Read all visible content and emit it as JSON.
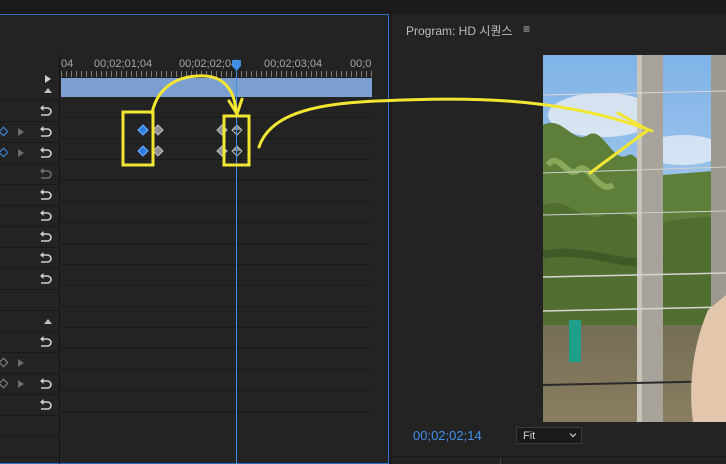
{
  "effect_controls": {
    "ruler_timecodes": [
      "04",
      "00;02;01;04",
      "00;02;02;04",
      "00;02;03;04",
      "00;0"
    ]
  },
  "program_monitor": {
    "title": "Program: HD 시퀀스",
    "menu_glyph": "≡",
    "timecode": "00;02;02;14",
    "fit_label": "Fit"
  },
  "colors": {
    "accent_blue": "#3f8ee8",
    "annotation_yellow": "#f2e633",
    "clip_bar": "#7b9fd1"
  },
  "icons": {
    "reset": "reset-icon",
    "play": "play-icon",
    "menu": "hamburger-icon"
  }
}
